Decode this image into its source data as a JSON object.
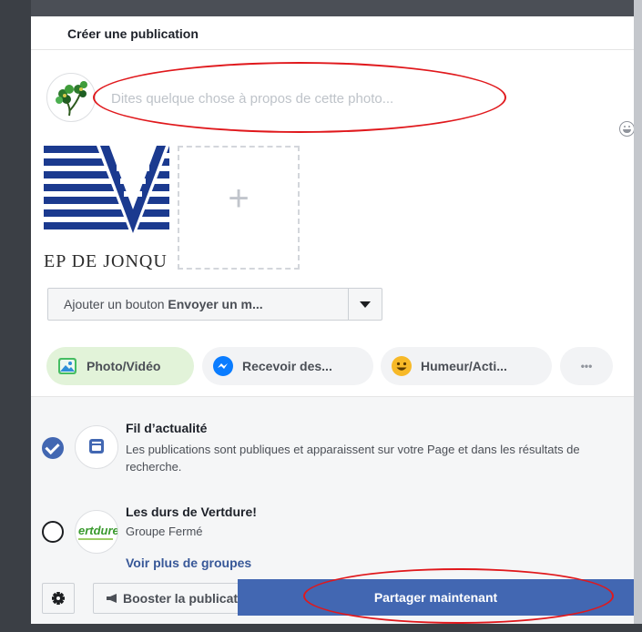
{
  "header": {
    "title": "Créer une publication"
  },
  "composer": {
    "placeholder": "Dites quelque chose à propos de cette photo..."
  },
  "attachment": {
    "thumb_text": "EP DE JONQU",
    "add_symbol": "+"
  },
  "cta": {
    "label": "Ajouter un bouton",
    "value": "Envoyer un m..."
  },
  "actions": [
    {
      "label": "Photo/Vidéo",
      "icon": "photo-icon"
    },
    {
      "label": "Recevoir des...",
      "icon": "messenger-icon"
    },
    {
      "label": "Humeur/Acti...",
      "icon": "smiley-icon"
    },
    {
      "label": "•••",
      "icon": "more-icon"
    }
  ],
  "audience": {
    "feed": {
      "title": "Fil d’actualité",
      "description": "Les publications sont publiques et apparaissent sur votre Page et dans les résultats de recherche."
    },
    "group": {
      "title": "Les durs de Vertdure!",
      "subtitle": "Groupe Fermé",
      "logo_text": "ertdure"
    },
    "more_groups": "Voir plus de groupes"
  },
  "footer": {
    "boost_label": "Booster la publication",
    "share_label": "Partager maintenant"
  },
  "colors": {
    "primary": "#4267b2",
    "link": "#385898",
    "annotation": "#e0181c",
    "active_pill": "#e2f3d9"
  }
}
